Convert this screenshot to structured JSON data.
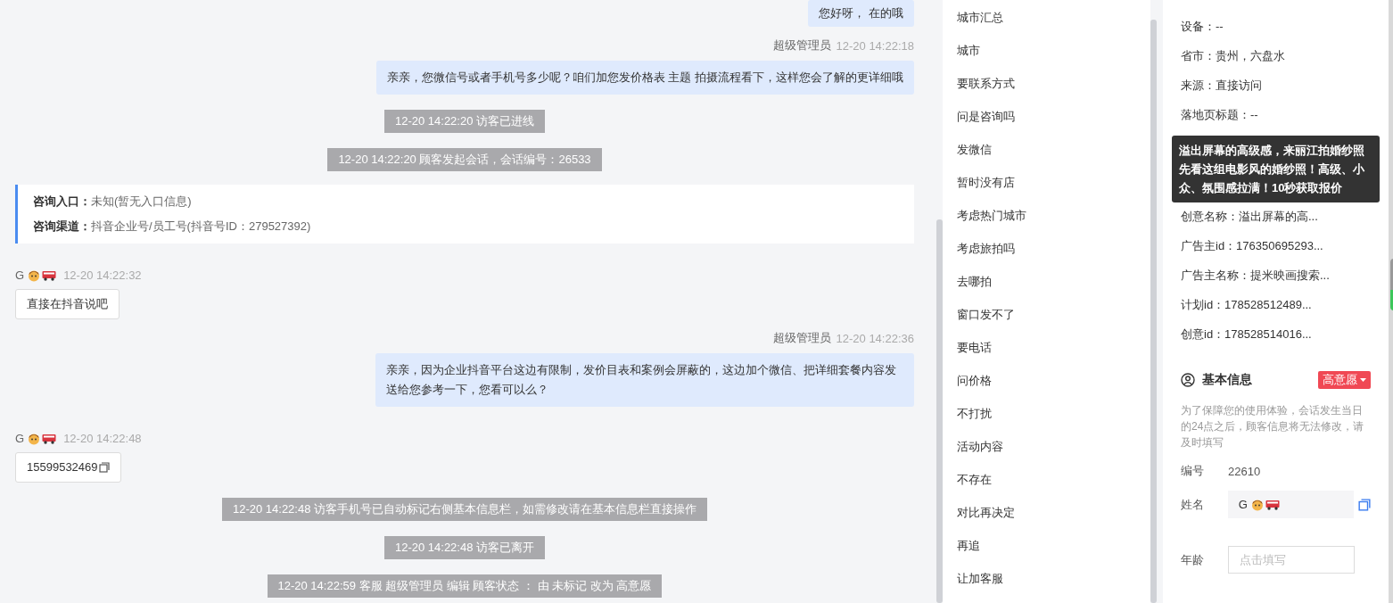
{
  "chat": [
    {
      "kind": "agent",
      "text": "您好呀， 在的哦"
    },
    {
      "kind": "agent",
      "sender": "超级管理员",
      "time": "12-20 14:22:18",
      "text": "亲亲，您微信号或者手机号多少呢？咱们加您发价格表 主题 拍摄流程看下，这样您会了解的更详细哦"
    },
    {
      "kind": "system",
      "text": "12-20 14:22:20 访客已进线"
    },
    {
      "kind": "system",
      "text": "12-20 14:22:20 顾客发起会话，会话编号：26533"
    },
    {
      "kind": "info",
      "lines": [
        {
          "label": "咨询入口：",
          "value": "未知(暂无入口信息)"
        },
        {
          "label": "咨询渠道：",
          "value": "抖音企业号/员工号(抖音号ID：279527392)"
        }
      ]
    },
    {
      "kind": "visitor",
      "sender": "G",
      "time": "12-20 14:22:32",
      "text": "直接在抖音说吧",
      "copy": false
    },
    {
      "kind": "agent",
      "sender": "超级管理员",
      "time": "12-20 14:22:36",
      "text": "亲亲，因为企业抖音平台这边有限制，发价目表和案例会屏蔽的，这边加个微信、把详细套餐内容发送给您参考一下，您看可以么？"
    },
    {
      "kind": "visitor",
      "sender": "G",
      "time": "12-20 14:22:48",
      "text": "15599532469",
      "copy": true
    },
    {
      "kind": "system",
      "text": "12-20 14:22:48 访客手机号已自动标记右侧基本信息栏，如需修改请在基本信息栏直接操作"
    },
    {
      "kind": "system",
      "text": "12-20 14:22:48 访客已离开"
    },
    {
      "kind": "system",
      "text": "12-20 14:22:59 客服 超级管理员 编辑 顾客状态 ： 由 未标记 改为 高意愿"
    }
  ],
  "quick_replies": [
    "城市汇总",
    "城市",
    "要联系方式",
    "问是咨询吗",
    "发微信",
    "暂时没有店",
    "考虑热门城市",
    "考虑旅拍吗",
    "去哪拍",
    "窗口发不了",
    "要电话",
    "问价格",
    "不打扰",
    "活动内容",
    "不存在",
    "对比再决定",
    "再追",
    "让加客服"
  ],
  "source_info": {
    "rows_before": [
      "设备：--",
      "省市：贵州，六盘水",
      "来源：直接访问",
      "落地页标题：--"
    ],
    "tooltip": "溢出屏幕的高级感，来丽江拍婚纱照先看这组电影风的婚纱照！高级、小众、氛围感拉满！10秒获取报价",
    "rows_after": [
      "创意名称：溢出屏幕的高...",
      "广告主id：176350695293...",
      "广告主名称：提米映画搜索...",
      "计划id：178528512489...",
      "创意id：178528514016..."
    ]
  },
  "basic_info": {
    "title": "基本信息",
    "status": "高意愿",
    "note": "为了保障您的使用体验，会话发生当日的24点之后，顾客信息将无法修改，请及时填写",
    "fields": [
      {
        "kind": "text",
        "label": "编号",
        "value": "22610"
      },
      {
        "kind": "name",
        "label": "姓名",
        "value": "G"
      },
      {
        "kind": "input",
        "label": "年龄",
        "placeholder": "点击填写"
      }
    ]
  }
}
